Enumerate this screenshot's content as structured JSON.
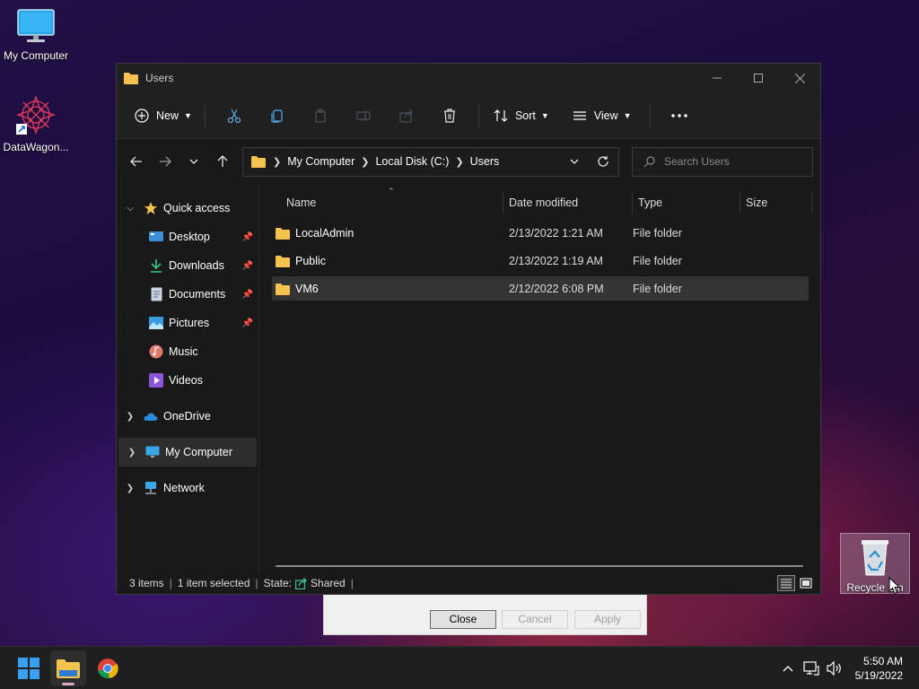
{
  "desktop": {
    "icons": [
      {
        "label": "My Computer",
        "icon": "monitor-icon"
      },
      {
        "label": "DataWagon...",
        "icon": "datawagon-app-icon"
      },
      {
        "label": "Recycle Bin",
        "icon": "recycle-bin-icon"
      }
    ]
  },
  "background_dialog": {
    "close_label": "Close",
    "cancel_label": "Cancel",
    "apply_label": "Apply"
  },
  "window": {
    "title": "Users",
    "toolbar": {
      "new_label": "New",
      "sort_label": "Sort",
      "view_label": "View"
    },
    "address": {
      "crumbs": [
        "My Computer",
        "Local Disk (C:)",
        "Users"
      ]
    },
    "search": {
      "placeholder": "Search Users"
    },
    "nav": {
      "quick_access": "Quick access",
      "quick_items": [
        {
          "label": "Desktop",
          "pinned": true
        },
        {
          "label": "Downloads",
          "pinned": true
        },
        {
          "label": "Documents",
          "pinned": true
        },
        {
          "label": "Pictures",
          "pinned": true
        },
        {
          "label": "Music",
          "pinned": false
        },
        {
          "label": "Videos",
          "pinned": false
        }
      ],
      "onedrive": "OneDrive",
      "my_computer": "My Computer",
      "network": "Network"
    },
    "columns": {
      "name": "Name",
      "date": "Date modified",
      "type": "Type",
      "size": "Size"
    },
    "files": [
      {
        "name": "LocalAdmin",
        "date": "2/13/2022 1:21 AM",
        "type": "File folder"
      },
      {
        "name": "Public",
        "date": "2/13/2022 1:19 AM",
        "type": "File folder"
      },
      {
        "name": "VM6",
        "date": "2/12/2022 6:08 PM",
        "type": "File folder",
        "selected": true
      }
    ],
    "status": {
      "items": "3 items",
      "selected": "1 item selected",
      "state_label": "State:",
      "state_value": "Shared"
    }
  },
  "taskbar": {
    "time": "5:50 AM",
    "date": "5/19/2022"
  },
  "colors": {
    "window_bg": "#191919",
    "accent_folder": "#f3c24f",
    "selection": "#333333"
  }
}
